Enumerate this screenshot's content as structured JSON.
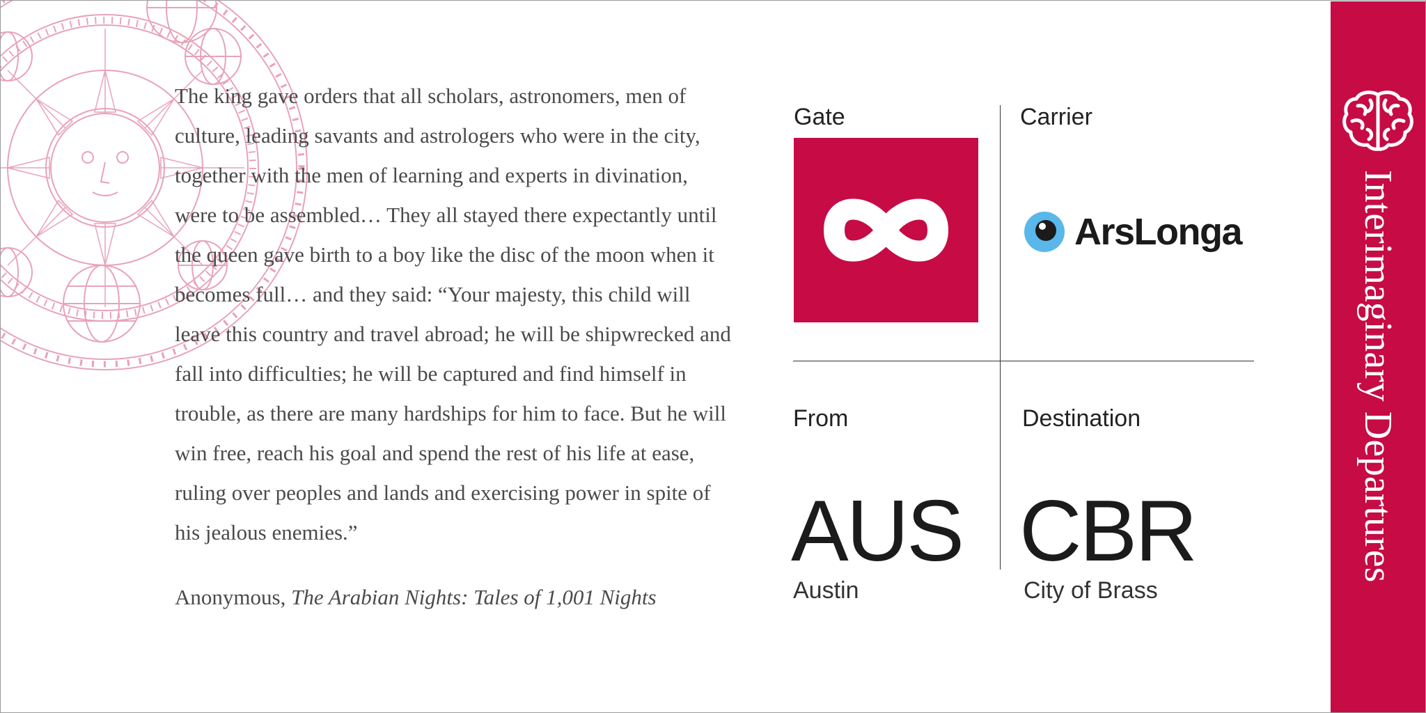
{
  "quote": {
    "text": "The king gave orders that all scholars, astronomers, men of culture, leading savants and astrologers who were in the city, together with the men of learning and experts in divination, were to be assembled… They all stayed there expectantly until the queen gave birth to a boy like the disc of the moon when it becomes full… and they said: “Your majesty, this child will leave this country and travel abroad; he will be shipwrecked and fall into difficulties; he will be captured and find himself in trouble, as there are many hardships for him to face. But he will win free, reach his goal and spend the rest of his life at ease, ruling over peoples and lands and exercising power in spite of his jealous enemies.”",
    "author": "Anonymous,",
    "work": "The Arabian Nights: Tales of 1,001 Nights"
  },
  "ticket": {
    "gate_label": "Gate",
    "carrier_label": "Carrier",
    "carrier_name": "ArsLonga",
    "from_label": "From",
    "from_code": "AUS",
    "from_city": "Austin",
    "destination_label": "Destination",
    "destination_code": "CBR",
    "destination_city": "City of Brass"
  },
  "sidebar": {
    "title": "Interimaginary Departures",
    "icon": "brain-icon"
  },
  "icons": {
    "gate": "infinity-icon",
    "carrier": "eye-icon",
    "decoration": "astronomical-engraving"
  },
  "colors": {
    "accent": "#c60b45",
    "engraving": "#e8a3b8",
    "carrier_eye": "#5ab7ea",
    "text": "#4a4a4a"
  }
}
